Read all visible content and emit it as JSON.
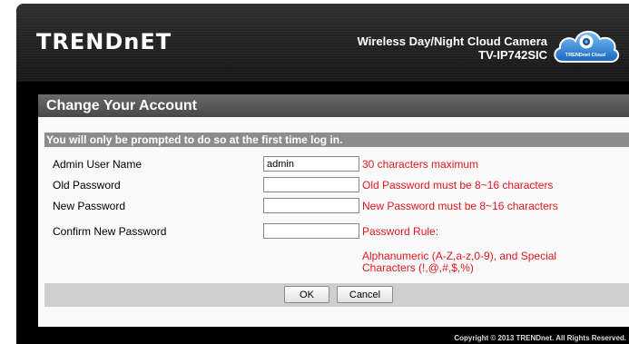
{
  "header": {
    "brand": "TRENDnET",
    "product_line": "Wireless Day/Night Cloud Camera",
    "model": "TV-IP742SIC",
    "cloud_label": "TRENDnet Cloud"
  },
  "panel": {
    "title": "Change Your Account",
    "notice": "You will only be prompted to do so at the first time log in."
  },
  "form": {
    "admin_user": {
      "label": "Admin User Name",
      "value": "admin",
      "hint": "30 characters maximum"
    },
    "old_password": {
      "label": "Old Password",
      "value": "",
      "hint": "Old Password must be 8~16 characters"
    },
    "new_password": {
      "label": "New Password",
      "value": "",
      "hint": "New Password must be 8~16 characters"
    },
    "confirm_password": {
      "label": "Confirm New Password",
      "value": "",
      "hint": "Password Rule:"
    },
    "rule_detail": "Alphanumeric (A-Z,a-z,0-9), and Special Characters (!,@,#,$,%)"
  },
  "buttons": {
    "ok": "OK",
    "cancel": "Cancel"
  },
  "footer": {
    "copyright": "Copyright © 2013 TRENDnet. All Rights Reserved."
  },
  "colors": {
    "hint_red": "#e1171e",
    "cloud_blue": "#2c88e0"
  }
}
